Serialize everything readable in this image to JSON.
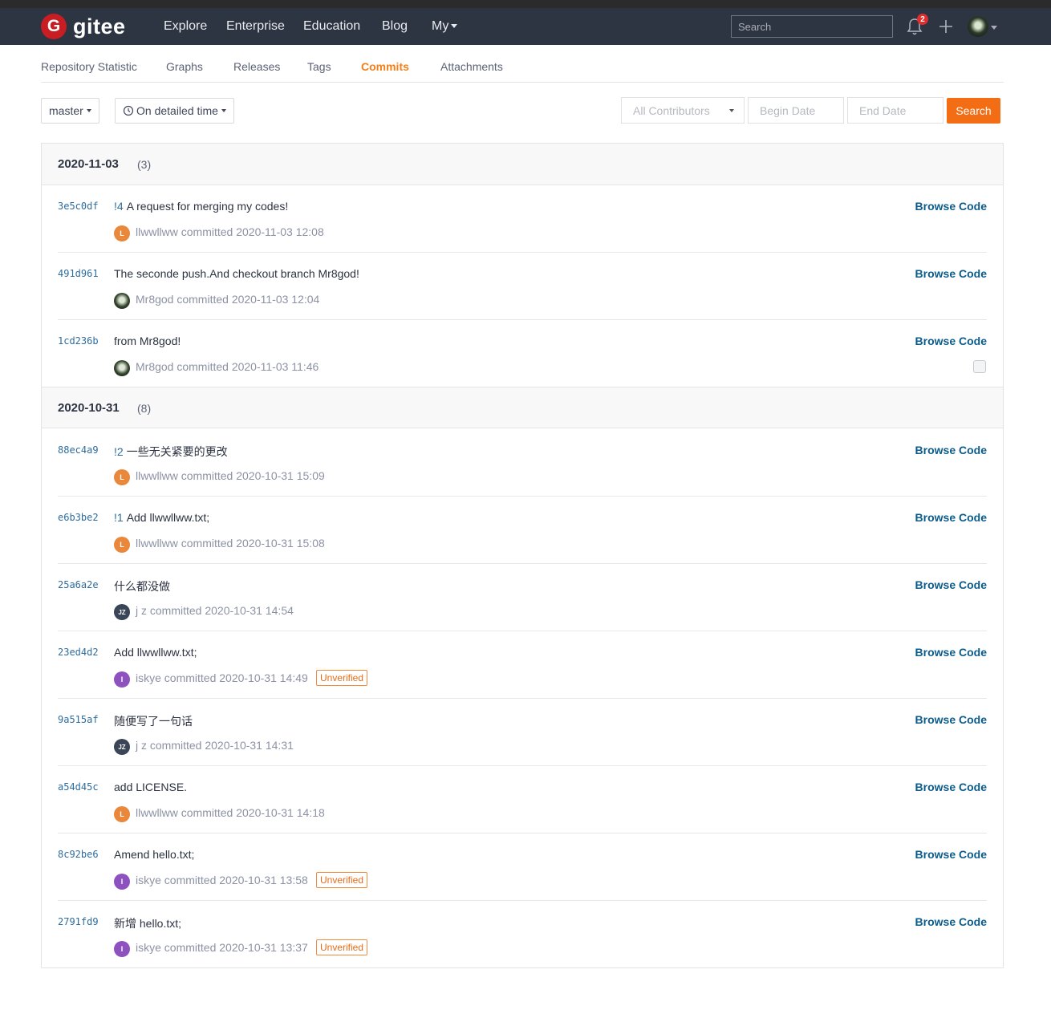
{
  "navbar": {
    "logo_letter": "G",
    "logo_text": "gitee",
    "items": [
      "Explore",
      "Enterprise",
      "Education",
      "Blog",
      "My"
    ],
    "search_placeholder": "Search",
    "notification_count": "2"
  },
  "subnav": {
    "items": [
      "Repository Statistic",
      "Graphs",
      "Releases",
      "Tags",
      "Commits",
      "Attachments"
    ],
    "active": "Commits"
  },
  "toolbar": {
    "branch": "master",
    "time_mode": "On detailed time",
    "contributors": "All Contributors",
    "begin_date_placeholder": "Begin Date",
    "end_date_placeholder": "End Date",
    "search_label": "Search"
  },
  "groups": [
    {
      "date": "2020-11-03",
      "count": "(3)",
      "commits": [
        {
          "sha": "3e5c0df",
          "pr": "!4",
          "message": "A request for merging my codes!",
          "avatar": "L",
          "meta": "llwwllww committed 2020-11-03 12:08",
          "browse": "Browse Code"
        },
        {
          "sha": "491d961",
          "pr": "",
          "message": "The seconde push.And checkout branch Mr8god!",
          "avatar": "",
          "meta": "Mr8god committed 2020-11-03 12:04",
          "browse": "Browse Code"
        },
        {
          "sha": "1cd236b",
          "pr": "",
          "message": "from Mr8god!",
          "avatar": "",
          "meta": "Mr8god committed 2020-11-03 11:46",
          "browse": "Browse Code"
        }
      ]
    },
    {
      "date": "2020-10-31",
      "count": "(8)",
      "commits": [
        {
          "sha": "88ec4a9",
          "pr": "!2",
          "message": "一些无关紧要的更改",
          "avatar": "L",
          "meta": "llwwllww committed 2020-10-31 15:09",
          "browse": "Browse Code"
        },
        {
          "sha": "e6b3be2",
          "pr": "!1",
          "message": "Add llwwllww.txt;",
          "avatar": "L",
          "meta": "llwwllww committed 2020-10-31 15:08",
          "browse": "Browse Code"
        },
        {
          "sha": "25a6a2e",
          "pr": "",
          "message": "什么都没做",
          "avatar": "JZ",
          "meta": "j z committed 2020-10-31 14:54",
          "browse": "Browse Code"
        },
        {
          "sha": "23ed4d2",
          "pr": "",
          "message": "Add llwwllww.txt;",
          "avatar": "I",
          "meta": "iskye committed 2020-10-31 14:49",
          "badge": "Unverified",
          "browse": "Browse Code"
        },
        {
          "sha": "9a515af",
          "pr": "",
          "message": "随便写了一句话",
          "avatar": "JZ",
          "meta": "j z committed 2020-10-31 14:31",
          "browse": "Browse Code"
        },
        {
          "sha": "a54d45c",
          "pr": "",
          "message": "add LICENSE.",
          "avatar": "L",
          "meta": "llwwllww committed 2020-10-31 14:18",
          "browse": "Browse Code"
        },
        {
          "sha": "8c92be6",
          "pr": "",
          "message": "Amend hello.txt;",
          "avatar": "I",
          "meta": "iskye committed 2020-10-31 13:58",
          "badge": "Unverified",
          "browse": "Browse Code"
        },
        {
          "sha": "2791fd9",
          "pr": "",
          "message": "新增 hello.txt;",
          "avatar": "I",
          "meta": "iskye committed 2020-10-31 13:37",
          "badge": "Unverified",
          "browse": "Browse Code"
        }
      ]
    }
  ],
  "colors": {
    "navbar_bg": "#2e3542",
    "accent_orange": "#f36d14",
    "link_blue": "#0b5c8c"
  }
}
